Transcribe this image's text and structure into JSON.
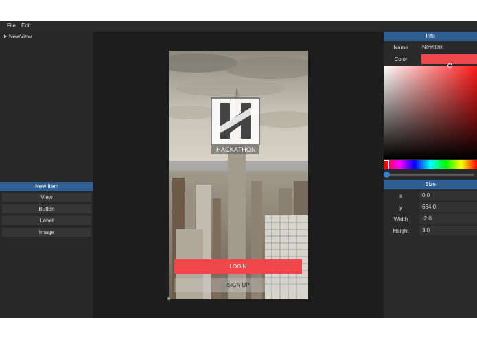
{
  "menubar": {
    "file": "File",
    "edit": "Edit"
  },
  "hierarchy": {
    "root_item": "NewView"
  },
  "new_item": {
    "header": "New Item",
    "buttons": [
      "View",
      "Button",
      "Label",
      "Image"
    ]
  },
  "canvas": {
    "logo_text": "HACKATHON",
    "login_label": "LOGIN",
    "signup_label": "SIGN UP",
    "login_color": "#f0474b"
  },
  "info": {
    "header": "Info",
    "name_label": "Name",
    "name_value": "NewItem",
    "color_label": "Color",
    "color_value": "#f0474b"
  },
  "size": {
    "header": "Size",
    "fields": [
      {
        "label": "x",
        "value": "0.0"
      },
      {
        "label": "y",
        "value": "664.0"
      },
      {
        "label": "Width",
        "value": "-2.0"
      },
      {
        "label": "Height",
        "value": "3.0"
      }
    ]
  }
}
